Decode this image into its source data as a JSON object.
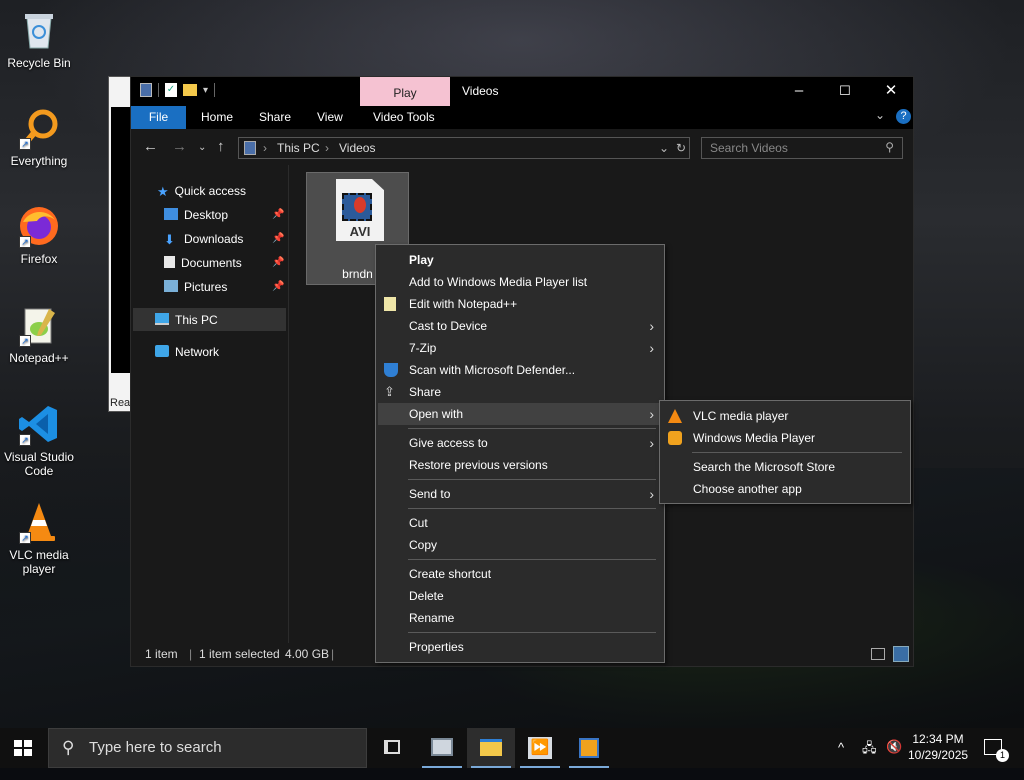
{
  "desktop": {
    "icons": [
      {
        "label": "Recycle Bin",
        "icon": "recycle-bin-icon"
      },
      {
        "label": "Everything",
        "icon": "everything-search-icon"
      },
      {
        "label": "Firefox",
        "icon": "firefox-icon"
      },
      {
        "label": "Notepad++",
        "icon": "notepad-plus-plus-icon"
      },
      {
        "label": "Visual Studio Code",
        "icon": "vscode-icon"
      },
      {
        "label": "VLC media player",
        "icon": "vlc-icon"
      }
    ],
    "behind_window_text": "Rea"
  },
  "explorer": {
    "title": "Videos",
    "context_tab": "Play",
    "ribbon_tabs": [
      "File",
      "Home",
      "Share",
      "View",
      "Video Tools"
    ],
    "address": {
      "crumbs": [
        "This PC",
        "Videos"
      ]
    },
    "search_placeholder": "Search Videos",
    "nav_items": [
      {
        "label": "Quick access",
        "icon": "star-icon",
        "pinned": false
      },
      {
        "label": "Desktop",
        "icon": "desktop-folder-icon",
        "pinned": true
      },
      {
        "label": "Downloads",
        "icon": "download-icon",
        "pinned": true
      },
      {
        "label": "Documents",
        "icon": "documents-icon",
        "pinned": true
      },
      {
        "label": "Pictures",
        "icon": "pictures-icon",
        "pinned": true
      },
      {
        "label": "This PC",
        "icon": "this-pc-icon",
        "pinned": false,
        "selected": true
      },
      {
        "label": "Network",
        "icon": "network-icon",
        "pinned": false
      }
    ],
    "file": {
      "name": "brndn",
      "badge": "AVI"
    },
    "status": {
      "count": "1 item",
      "selected": "1 item selected",
      "size": "4.00 GB"
    }
  },
  "context_menu": {
    "items": [
      {
        "label": "Play",
        "bold": true
      },
      {
        "label": "Add to Windows Media Player list"
      },
      {
        "label": "Edit with Notepad++",
        "icon": "notepad-plus-plus-icon"
      },
      {
        "label": "Cast to Device",
        "submenu": true
      },
      {
        "label": "7-Zip",
        "submenu": true
      },
      {
        "label": "Scan with Microsoft Defender...",
        "icon": "defender-shield-icon"
      },
      {
        "label": "Share",
        "icon": "share-icon"
      },
      {
        "label": "Open with",
        "submenu": true,
        "highlighted": true
      },
      {
        "label": "Give access to",
        "submenu": true
      },
      {
        "label": "Restore previous versions"
      },
      {
        "label": "Send to",
        "submenu": true
      },
      {
        "label": "Cut"
      },
      {
        "label": "Copy"
      },
      {
        "label": "Create shortcut"
      },
      {
        "label": "Delete"
      },
      {
        "label": "Rename"
      },
      {
        "label": "Properties"
      }
    ]
  },
  "open_with_menu": {
    "items": [
      {
        "label": "VLC media player",
        "icon": "vlc-icon"
      },
      {
        "label": "Windows Media Player",
        "icon": "windows-media-player-icon"
      },
      {
        "label": "Search the Microsoft Store"
      },
      {
        "label": "Choose another app"
      }
    ]
  },
  "taskbar": {
    "search_placeholder": "Type here to search",
    "time": "12:34 PM",
    "date": "10/29/2025",
    "notification_count": "1"
  }
}
